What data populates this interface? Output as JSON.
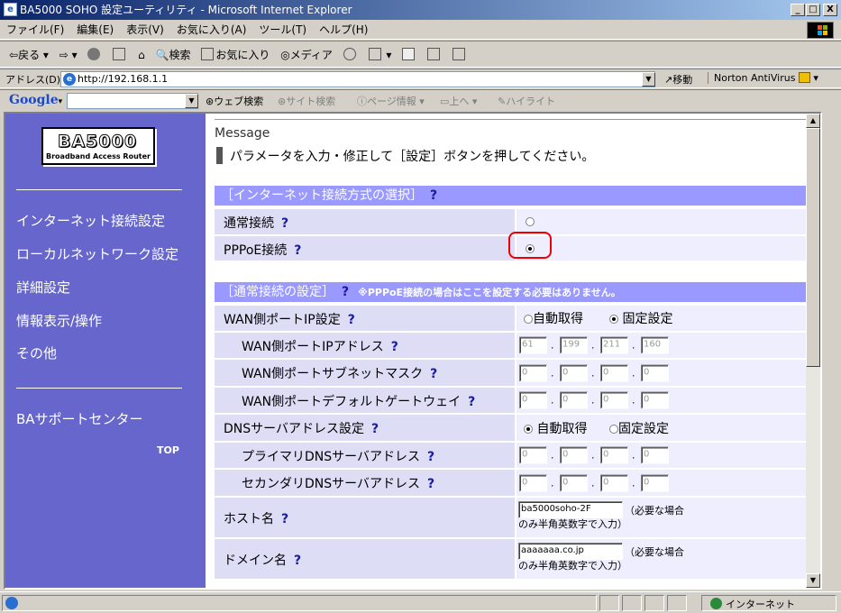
{
  "window": {
    "title": "BA5000 SOHO 設定ユーティリティ - Microsoft Internet Explorer",
    "minimize": "_",
    "maximize": "□",
    "close": "X"
  },
  "menu": [
    "ファイル(F)",
    "編集(E)",
    "表示(V)",
    "お気に入り(A)",
    "ツール(T)",
    "ヘルプ(H)"
  ],
  "toolbar": {
    "back": "戻る",
    "search": "検索",
    "favorites": "お気に入り",
    "media": "メディア"
  },
  "address": {
    "label": "アドレス(D)",
    "url": "http://192.168.1.1",
    "go": "移動",
    "norton": "Norton AntiVirus"
  },
  "google": {
    "logo": "Google",
    "web_search": "ウェブ検索",
    "site_search": "サイト検索",
    "page_info": "ページ情報",
    "up": "上へ",
    "highlight": "ハイライト"
  },
  "sidebar": {
    "logo_main": "BA5000",
    "logo_sub": "Broadband Access Router",
    "links": [
      "インターネット接続設定",
      "ローカルネットワーク設定",
      "詳細設定",
      "情報表示/操作",
      "その他"
    ],
    "support": "BAサポートセンター",
    "top": "TOP"
  },
  "main": {
    "message_title": "Message",
    "message_text": "パラメータを入力・修正して［設定］ボタンを押してください。",
    "help_mark": "?",
    "section1": {
      "title": "［インターネット接続方式の選択］",
      "rows": [
        {
          "label": "通常接続",
          "selected": false
        },
        {
          "label": "PPPoE接続",
          "selected": true
        }
      ]
    },
    "section2": {
      "title": "［通常接続の設定］",
      "note": "※PPPoE接続の場合はここを設定する必要はありません。",
      "wan_mode": {
        "label": "WAN側ポートIP設定",
        "auto": "自動取得",
        "fixed": "固定設定",
        "selected": "fixed"
      },
      "wan_ip": {
        "label": "WAN側ポートIPアドレス",
        "octets": [
          "61",
          "199",
          "211",
          "160"
        ]
      },
      "wan_mask": {
        "label": "WAN側ポートサブネットマスク",
        "octets": [
          "0",
          "0",
          "0",
          "0"
        ]
      },
      "wan_gw": {
        "label": "WAN側ポートデフォルトゲートウェイ",
        "octets": [
          "0",
          "0",
          "0",
          "0"
        ]
      },
      "dns_mode": {
        "label": "DNSサーバアドレス設定",
        "auto": "自動取得",
        "fixed": "固定設定",
        "selected": "auto"
      },
      "dns1": {
        "label": "プライマリDNSサーバアドレス",
        "octets": [
          "0",
          "0",
          "0",
          "0"
        ]
      },
      "dns2": {
        "label": "セカンダリDNSサーバアドレス",
        "octets": [
          "0",
          "0",
          "0",
          "0"
        ]
      },
      "host": {
        "label": "ホスト名",
        "value": "ba5000soho-2F",
        "hint": "（必要な場合のみ半角英数字で入力）"
      },
      "domain": {
        "label": "ドメイン名",
        "value": "aaaaaaa.co.jp",
        "hint": "（必要な場合のみ半角英数字で入力）"
      }
    }
  },
  "status": {
    "zone": "インターネット"
  }
}
